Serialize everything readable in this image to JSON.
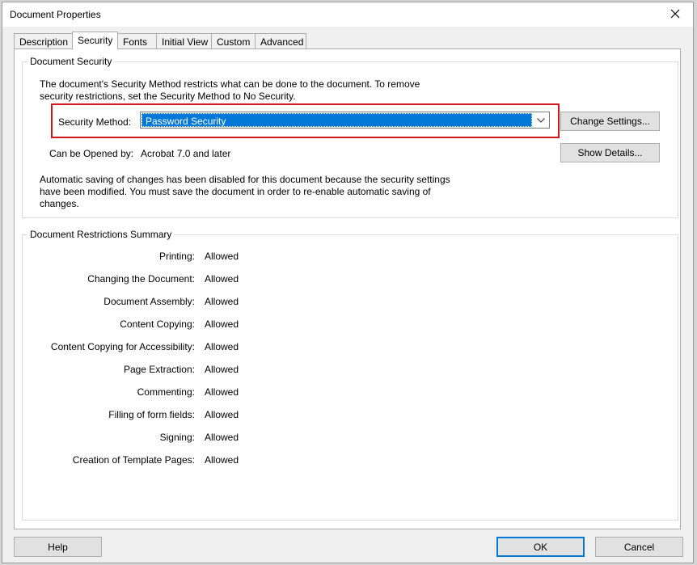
{
  "window": {
    "title": "Document Properties",
    "close_icon": "close-icon"
  },
  "tabs": [
    {
      "label": "Description",
      "active": false
    },
    {
      "label": "Security",
      "active": true
    },
    {
      "label": "Fonts",
      "active": false
    },
    {
      "label": "Initial View",
      "active": false
    },
    {
      "label": "Custom",
      "active": false
    },
    {
      "label": "Advanced",
      "active": false
    }
  ],
  "document_security": {
    "group_title": "Document Security",
    "intro_line1": "The document's Security Method restricts what can be done to the document. To remove",
    "intro_line2": "security restrictions, set the Security Method to No Security.",
    "security_method_label": "Security Method:",
    "security_method_value": "Password Security",
    "change_settings_button": "Change Settings...",
    "opened_by_label": "Can be Opened by:",
    "opened_by_value": "Acrobat 7.0 and later",
    "show_details_button": "Show Details...",
    "autosave_line1": "Automatic saving of changes has been disabled for this document because the security settings",
    "autosave_line2": "have been modified. You must save the document in order to re-enable automatic saving of",
    "autosave_line3": "changes.",
    "highlight_color": "#d0151b"
  },
  "restrictions": {
    "group_title": "Document Restrictions Summary",
    "rows": [
      {
        "label": "Printing:",
        "value": "Allowed"
      },
      {
        "label": "Changing the Document:",
        "value": "Allowed"
      },
      {
        "label": "Document Assembly:",
        "value": "Allowed"
      },
      {
        "label": "Content Copying:",
        "value": "Allowed"
      },
      {
        "label": "Content Copying for Accessibility:",
        "value": "Allowed"
      },
      {
        "label": "Page Extraction:",
        "value": "Allowed"
      },
      {
        "label": "Commenting:",
        "value": "Allowed"
      },
      {
        "label": "Filling of form fields:",
        "value": "Allowed"
      },
      {
        "label": "Signing:",
        "value": "Allowed"
      },
      {
        "label": "Creation of Template Pages:",
        "value": "Allowed"
      }
    ]
  },
  "footer": {
    "help_button": "Help",
    "ok_button": "OK",
    "cancel_button": "Cancel"
  },
  "colors": {
    "selection": "#0078d7",
    "dialog_bg": "#f0f0f0"
  }
}
